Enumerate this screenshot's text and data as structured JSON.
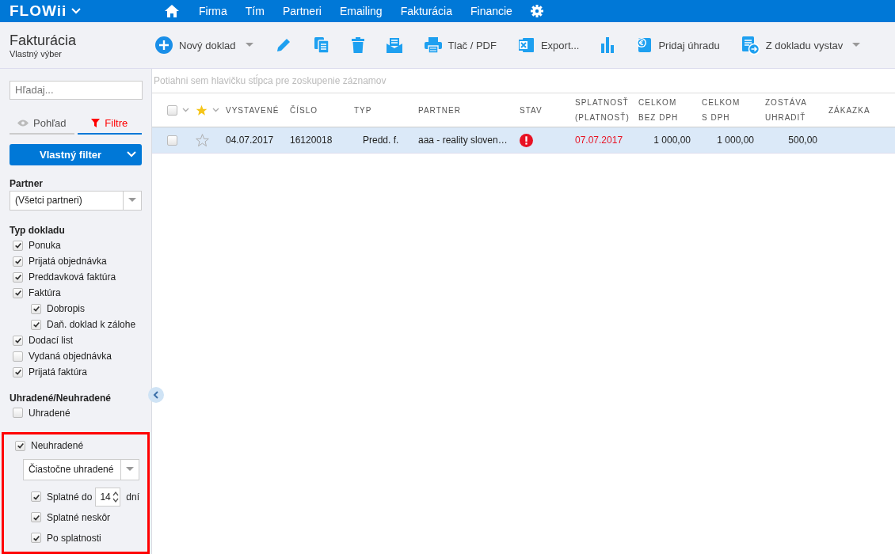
{
  "nav": {
    "logo": "FLOWii",
    "items": [
      {
        "label": "Firma"
      },
      {
        "label": "Tím"
      },
      {
        "label": "Partneri"
      },
      {
        "label": "Emailing"
      },
      {
        "label": "Fakturácia"
      },
      {
        "label": "Financie"
      }
    ]
  },
  "header": {
    "title": "Fakturácia",
    "subtitle": "Vlastný výber"
  },
  "toolbar": [
    {
      "kind": "new",
      "label": "Nový doklad",
      "dropdown": true
    },
    {
      "kind": "edit",
      "dropdown": false
    },
    {
      "kind": "copy",
      "dropdown": false
    },
    {
      "kind": "delete",
      "dropdown": false
    },
    {
      "kind": "mail",
      "dropdown": false
    },
    {
      "kind": "print",
      "label": "Tlač / PDF",
      "dropdown": false
    },
    {
      "kind": "export",
      "label": "Export...",
      "dropdown": false
    },
    {
      "kind": "chart",
      "dropdown": false
    },
    {
      "kind": "payment",
      "label": "Pridaj úhradu",
      "dropdown": false
    },
    {
      "kind": "convert",
      "label": "Z dokladu vystav",
      "dropdown": true
    }
  ],
  "sidebar": {
    "search": {
      "placeholder": "Hľadaj..."
    },
    "tabs": [
      {
        "kind": "view",
        "label": "Pohľad",
        "selected": false
      },
      {
        "kind": "filter",
        "label": "Filtre",
        "selected": true
      }
    ],
    "filter_button": "Vlastný filter",
    "partner": {
      "label": "Partner",
      "value": "(Všetci partneri)"
    },
    "doc_types": {
      "title": "Typ dokladu",
      "items": [
        {
          "label": "Ponuka",
          "checked": true
        },
        {
          "label": "Prijatá objednávka",
          "checked": true
        },
        {
          "label": "Preddavková faktúra",
          "checked": true
        },
        {
          "label": "Faktúra",
          "checked": true,
          "children": [
            {
              "label": "Dobropis",
              "checked": true
            },
            {
              "label": "Daň. doklad k zálohe",
              "checked": true
            }
          ]
        },
        {
          "label": "Dodací list",
          "checked": true
        },
        {
          "label": "Vydaná objednávka",
          "checked": false
        },
        {
          "label": "Prijatá faktúra",
          "checked": true
        }
      ]
    },
    "payment": {
      "title": "Uhradené/Neuhradené",
      "items": [
        {
          "label": "Uhradené",
          "checked": false
        }
      ],
      "unpaid": {
        "label": "Neuhradené",
        "checked": true,
        "highlighted": true,
        "select": "Čiastočne uhradené",
        "options": [
          {
            "kind": "days",
            "label": "Splatné do",
            "value": "14",
            "unit": "dní",
            "checked": true
          },
          {
            "kind": "plain",
            "label": "Splatné neskôr",
            "checked": true
          },
          {
            "kind": "plain",
            "label": "Po splatnosti",
            "checked": true
          }
        ]
      }
    }
  },
  "grid": {
    "group_hint": "Potiahni sem hlavičku stĺpca pre zoskupenie záznamov",
    "select_all": {
      "checked": false
    },
    "columns": [
      {
        "label": "VYSTAVENÉ"
      },
      {
        "label": "ČÍSLO"
      },
      {
        "label": "TYP"
      },
      {
        "label": "PARTNER"
      },
      {
        "label": "STAV"
      },
      {
        "label": "SPLATNOSŤ",
        "sublabel": "(PLATNOSŤ)"
      },
      {
        "label": "CELKOM",
        "sublabel": "BEZ DPH"
      },
      {
        "label": "CELKOM",
        "sublabel": "S DPH"
      },
      {
        "label": "ZOSTÁVA",
        "sublabel": "UHRADIŤ"
      },
      {
        "label": "ZÁKAZKA"
      }
    ],
    "rows": [
      {
        "selected": true,
        "checked": false,
        "starred": false,
        "issued": "04.07.2017",
        "number": "16120018",
        "type": "Predd. f.",
        "partner": "aaa - reality sloven…",
        "error": true,
        "due": "07.07.2017",
        "overdue": true,
        "net": "1 000,00",
        "gross": "1 000,00",
        "remaining": "500,00"
      }
    ]
  }
}
